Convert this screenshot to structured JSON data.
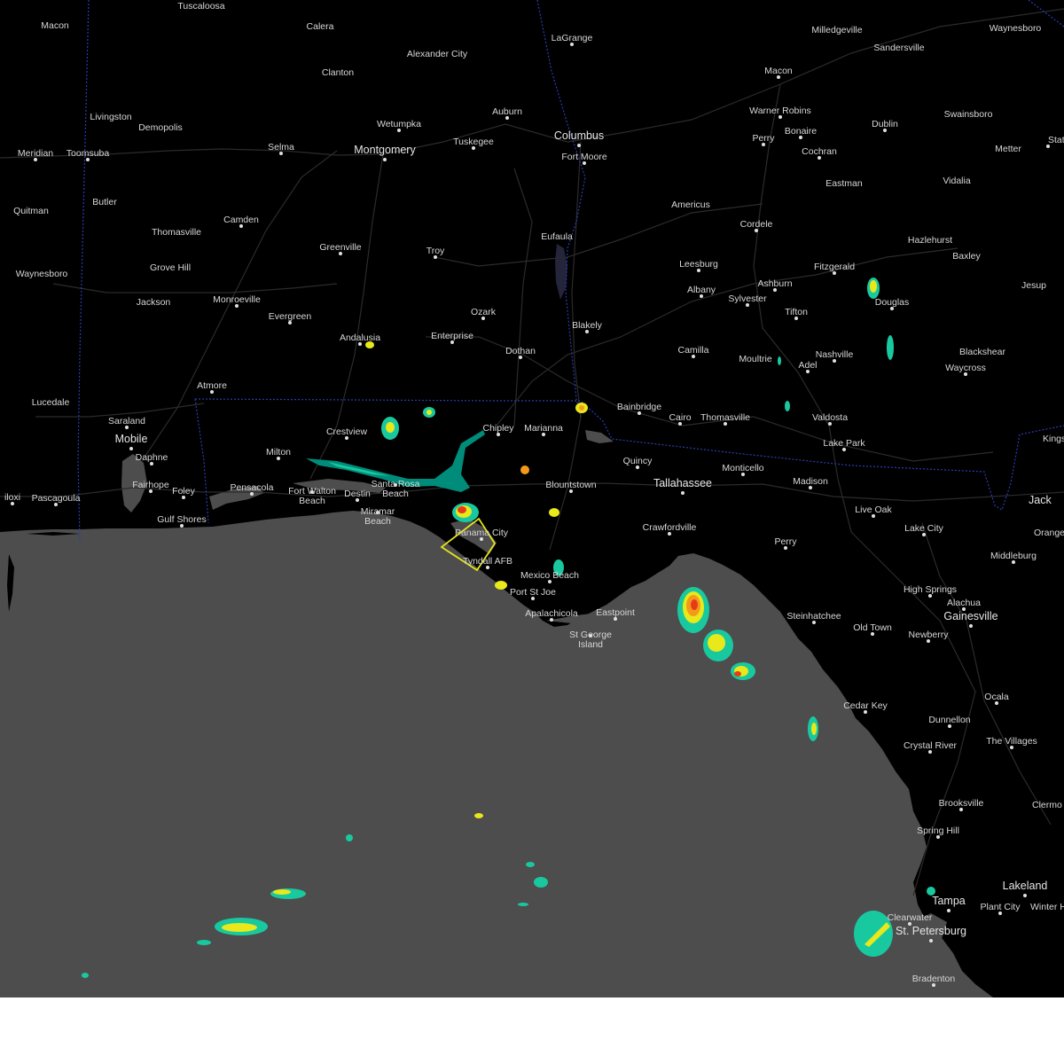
{
  "map": {
    "colors": {
      "land": "#000000",
      "water": "#4d4d4d",
      "road": "#2b2b2b",
      "border": "#2a3db0",
      "label": "#d7d7d7",
      "warning_polygon": "#e5e519",
      "below_map": "#ffffff"
    },
    "radar_palette": [
      "#008c7a",
      "#18c9a0",
      "#e8e81a",
      "#f39a1a",
      "#e63b1a"
    ],
    "warning_polygon_label": "severe thunderstorm warning",
    "cities": [
      {
        "id": "tuscaloosa",
        "name": "Tuscaloosa"
      },
      {
        "id": "macon-ms",
        "name": "Macon"
      },
      {
        "id": "calera",
        "name": "Calera"
      },
      {
        "id": "lagrange",
        "name": "LaGrange"
      },
      {
        "id": "milledgeville",
        "name": "Milledgeville"
      },
      {
        "id": "waynesboro-ga",
        "name": "Waynesboro"
      },
      {
        "id": "sandersville",
        "name": "Sandersville"
      },
      {
        "id": "alexander-city",
        "name": "Alexander City"
      },
      {
        "id": "clanton",
        "name": "Clanton"
      },
      {
        "id": "macon-ga",
        "name": "Macon"
      },
      {
        "id": "livingston",
        "name": "Livingston"
      },
      {
        "id": "auburn",
        "name": "Auburn"
      },
      {
        "id": "warner-robins",
        "name": "Warner Robins"
      },
      {
        "id": "swainsboro",
        "name": "Swainsboro"
      },
      {
        "id": "demopolis",
        "name": "Demopolis"
      },
      {
        "id": "wetumpka",
        "name": "Wetumpka"
      },
      {
        "id": "tuskegee",
        "name": "Tuskegee"
      },
      {
        "id": "columbus",
        "name": "Columbus",
        "major": true
      },
      {
        "id": "bonaire",
        "name": "Bonaire"
      },
      {
        "id": "dublin",
        "name": "Dublin"
      },
      {
        "id": "perry-ga",
        "name": "Perry"
      },
      {
        "id": "statesboro",
        "name": "Statesbo"
      },
      {
        "id": "meridian",
        "name": "Meridian"
      },
      {
        "id": "toomsuba",
        "name": "Toomsuba"
      },
      {
        "id": "selma",
        "name": "Selma"
      },
      {
        "id": "montgomery",
        "name": "Montgomery",
        "major": true
      },
      {
        "id": "fort-moore",
        "name": "Fort Moore"
      },
      {
        "id": "cochran",
        "name": "Cochran"
      },
      {
        "id": "metter",
        "name": "Metter"
      },
      {
        "id": "eastman",
        "name": "Eastman"
      },
      {
        "id": "vidalia",
        "name": "Vidalia"
      },
      {
        "id": "butler",
        "name": "Butler"
      },
      {
        "id": "americus",
        "name": "Americus"
      },
      {
        "id": "quitman",
        "name": "Quitman"
      },
      {
        "id": "camden",
        "name": "Camden"
      },
      {
        "id": "cordele",
        "name": "Cordele"
      },
      {
        "id": "thomasville-al",
        "name": "Thomasville"
      },
      {
        "id": "eufaula",
        "name": "Eufaula"
      },
      {
        "id": "hazlehurst",
        "name": "Hazlehurst"
      },
      {
        "id": "greenville",
        "name": "Greenville"
      },
      {
        "id": "troy",
        "name": "Troy"
      },
      {
        "id": "baxley",
        "name": "Baxley"
      },
      {
        "id": "leesburg",
        "name": "Leesburg"
      },
      {
        "id": "fitzgerald",
        "name": "Fitzgerald"
      },
      {
        "id": "grove-hill",
        "name": "Grove Hill"
      },
      {
        "id": "waynesboro-ms",
        "name": "Waynesboro"
      },
      {
        "id": "albany",
        "name": "Albany"
      },
      {
        "id": "ashburn",
        "name": "Ashburn"
      },
      {
        "id": "jesup",
        "name": "Jesup"
      },
      {
        "id": "monroeville",
        "name": "Monroeville"
      },
      {
        "id": "jackson",
        "name": "Jackson"
      },
      {
        "id": "sylvester",
        "name": "Sylvester"
      },
      {
        "id": "douglas",
        "name": "Douglas"
      },
      {
        "id": "ozark",
        "name": "Ozark"
      },
      {
        "id": "tifton",
        "name": "Tifton"
      },
      {
        "id": "evergreen",
        "name": "Evergreen"
      },
      {
        "id": "blakely",
        "name": "Blakely"
      },
      {
        "id": "enterprise",
        "name": "Enterprise"
      },
      {
        "id": "andalusia",
        "name": "Andalusia"
      },
      {
        "id": "dothan",
        "name": "Dothan"
      },
      {
        "id": "camilla",
        "name": "Camilla"
      },
      {
        "id": "blackshear",
        "name": "Blackshear"
      },
      {
        "id": "adel",
        "name": "Adel"
      },
      {
        "id": "nashville",
        "name": "Nashville"
      },
      {
        "id": "moultrie",
        "name": "Moultrie"
      },
      {
        "id": "waycross",
        "name": "Waycross"
      },
      {
        "id": "atmore",
        "name": "Atmore"
      },
      {
        "id": "lucedale",
        "name": "Lucedale"
      },
      {
        "id": "bainbridge",
        "name": "Bainbridge"
      },
      {
        "id": "valdosta",
        "name": "Valdosta"
      },
      {
        "id": "cairo",
        "name": "Cairo"
      },
      {
        "id": "thomasville-ga",
        "name": "Thomasville"
      },
      {
        "id": "saraland",
        "name": "Saraland"
      },
      {
        "id": "chipley",
        "name": "Chipley"
      },
      {
        "id": "marianna",
        "name": "Marianna"
      },
      {
        "id": "crestview",
        "name": "Crestview"
      },
      {
        "id": "kings",
        "name": "Kings"
      },
      {
        "id": "mobile",
        "name": "Mobile",
        "major": true
      },
      {
        "id": "lake-park",
        "name": "Lake Park"
      },
      {
        "id": "milton",
        "name": "Milton"
      },
      {
        "id": "daphne",
        "name": "Daphne"
      },
      {
        "id": "quincy",
        "name": "Quincy"
      },
      {
        "id": "monticello",
        "name": "Monticello"
      },
      {
        "id": "santa-rosa-beach",
        "name": "Santa Rosa\nBeach"
      },
      {
        "id": "fairhope",
        "name": "Fairhope"
      },
      {
        "id": "blountstown",
        "name": "Blountstown"
      },
      {
        "id": "tallahassee",
        "name": "Tallahassee",
        "major": true
      },
      {
        "id": "madison",
        "name": "Madison"
      },
      {
        "id": "foley",
        "name": "Foley"
      },
      {
        "id": "pensacola",
        "name": "Pensacola"
      },
      {
        "id": "fort-walton-beach",
        "name": "Fort Walton\nBeach"
      },
      {
        "id": "destin",
        "name": "Destin"
      },
      {
        "id": "biloxi",
        "name": "iloxi"
      },
      {
        "id": "pascagoula",
        "name": "Pascagoula"
      },
      {
        "id": "jacksonville",
        "name": "Jack",
        "major": true
      },
      {
        "id": "live-oak",
        "name": "Live Oak"
      },
      {
        "id": "miramar-beach",
        "name": "Miramar\nBeach"
      },
      {
        "id": "gulf-shores",
        "name": "Gulf Shores"
      },
      {
        "id": "lake-city",
        "name": "Lake City"
      },
      {
        "id": "orange-park",
        "name": "Orange"
      },
      {
        "id": "crawfordville",
        "name": "Crawfordville"
      },
      {
        "id": "panama-city",
        "name": "Panama City"
      },
      {
        "id": "perry-fl",
        "name": "Perry"
      },
      {
        "id": "middleburg",
        "name": "Middleburg"
      },
      {
        "id": "tyndall-afb",
        "name": "Tyndall AFB"
      },
      {
        "id": "mexico-beach",
        "name": "Mexico Beach"
      },
      {
        "id": "high-springs",
        "name": "High Springs"
      },
      {
        "id": "port-st-joe",
        "name": "Port St Joe"
      },
      {
        "id": "alachua",
        "name": "Alachua"
      },
      {
        "id": "apalachicola",
        "name": "Apalachicola"
      },
      {
        "id": "eastpoint",
        "name": "Eastpoint"
      },
      {
        "id": "steinhatchee",
        "name": "Steinhatchee"
      },
      {
        "id": "gainesville",
        "name": "Gainesville",
        "major": true
      },
      {
        "id": "st-george-island",
        "name": "St George\nIsland"
      },
      {
        "id": "old-town",
        "name": "Old Town"
      },
      {
        "id": "newberry",
        "name": "Newberry"
      },
      {
        "id": "cedar-key",
        "name": "Cedar Key"
      },
      {
        "id": "ocala",
        "name": "Ocala"
      },
      {
        "id": "dunnellon",
        "name": "Dunnellon"
      },
      {
        "id": "the-villages",
        "name": "The Villages"
      },
      {
        "id": "crystal-river",
        "name": "Crystal River"
      },
      {
        "id": "brooksville",
        "name": "Brooksville"
      },
      {
        "id": "clermont",
        "name": "Clermo"
      },
      {
        "id": "spring-hill",
        "name": "Spring Hill"
      },
      {
        "id": "lakeland",
        "name": "Lakeland",
        "major": true
      },
      {
        "id": "tampa",
        "name": "Tampa",
        "major": true
      },
      {
        "id": "plant-city",
        "name": "Plant City"
      },
      {
        "id": "winter-haven",
        "name": "Winter H"
      },
      {
        "id": "clearwater",
        "name": "Clearwater"
      },
      {
        "id": "st-petersburg",
        "name": "St. Petersburg",
        "major": true
      },
      {
        "id": "bradenton",
        "name": "Bradenton"
      }
    ]
  }
}
